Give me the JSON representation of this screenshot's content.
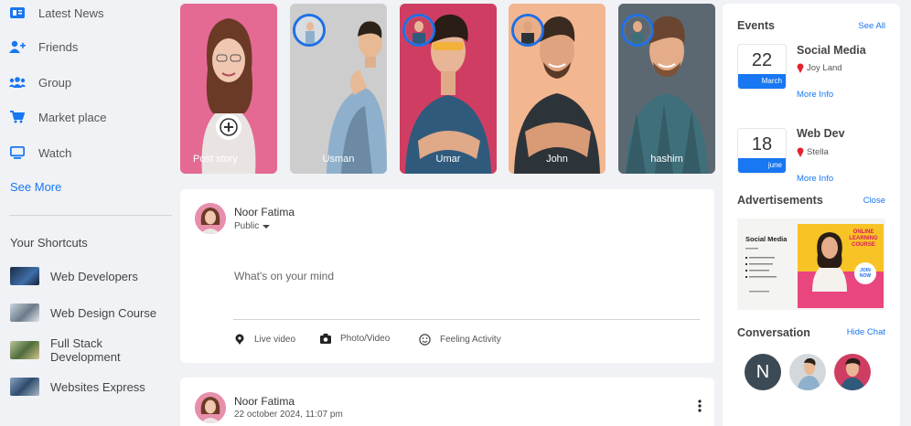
{
  "sidebar": {
    "items": [
      {
        "label": "Latest News"
      },
      {
        "label": "Friends"
      },
      {
        "label": "Group"
      },
      {
        "label": "Market place"
      },
      {
        "label": "Watch"
      }
    ],
    "see_more": "See More",
    "shortcuts_title": "Your Shortcuts",
    "shortcuts": [
      {
        "label": "Web Developers"
      },
      {
        "label": "Web Design Course"
      },
      {
        "label": "Full Stack Development"
      },
      {
        "label": "Websites Express"
      }
    ]
  },
  "stories": [
    {
      "name": "Post story",
      "bg": "#e04f84"
    },
    {
      "name": "Usman",
      "bg": "#c9c9c9"
    },
    {
      "name": "Umar",
      "bg": "#cc3b5e"
    },
    {
      "name": "John",
      "bg": "#f2b38d"
    },
    {
      "name": "hashim",
      "bg": "#5b6770"
    }
  ],
  "composer": {
    "user": "Noor Fatima",
    "audience": "Public",
    "placeholder": "What's on your mind",
    "actions": [
      {
        "label": "Live video"
      },
      {
        "label": "Photo/Video"
      },
      {
        "label": "Feeling Activity"
      }
    ]
  },
  "post": {
    "user": "Noor Fatima",
    "timestamp": "22 october 2024, 11:07 pm"
  },
  "events": {
    "title": "Events",
    "see_all": "See All",
    "list": [
      {
        "day": "22",
        "month": "March",
        "title": "Social Media",
        "location": "Joy Land",
        "more": "More Info"
      },
      {
        "day": "18",
        "month": "june",
        "title": "Web Dev",
        "location": "Stella",
        "more": "More Info"
      }
    ]
  },
  "ads": {
    "title": "Advertisements",
    "close": "Close",
    "banner": {
      "heading": "Social Media",
      "tag": "ONLINE LEARNING COURSE",
      "join": "JOIN NOW"
    }
  },
  "conversation": {
    "title": "Conversation",
    "hide": "Hide Chat",
    "contacts": [
      {
        "initial": "N"
      },
      {
        "initial": ""
      },
      {
        "initial": ""
      }
    ]
  },
  "colors": {
    "accent": "#1877f2",
    "ring": "#1f6fe5",
    "background": "#f0f2f5"
  }
}
